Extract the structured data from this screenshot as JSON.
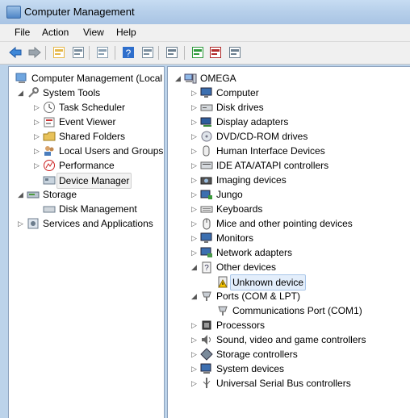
{
  "window": {
    "title": "Computer Management"
  },
  "menu": [
    "File",
    "Action",
    "View",
    "Help"
  ],
  "toolbar": [
    "back-icon",
    "forward-icon",
    "up-folder-icon",
    "show-hide-tree-icon",
    "properties-icon",
    "help-icon",
    "show-action-pane-icon",
    "scan-hardware-icon",
    "update-driver-icon",
    "uninstall-icon",
    "disable-icon"
  ],
  "left_tree": [
    {
      "label": "Computer Management (Local",
      "level": 0,
      "expander": "",
      "icon": "computer-management-icon"
    },
    {
      "label": "System Tools",
      "level": 1,
      "expander": "▲",
      "icon": "system-tools-icon"
    },
    {
      "label": "Task Scheduler",
      "level": 2,
      "expander": "▷",
      "icon": "clock-icon"
    },
    {
      "label": "Event Viewer",
      "level": 2,
      "expander": "▷",
      "icon": "event-viewer-icon"
    },
    {
      "label": "Shared Folders",
      "level": 2,
      "expander": "▷",
      "icon": "shared-folder-icon"
    },
    {
      "label": "Local Users and Groups",
      "level": 2,
      "expander": "▷",
      "icon": "users-icon"
    },
    {
      "label": "Performance",
      "level": 2,
      "expander": "▷",
      "icon": "performance-icon"
    },
    {
      "label": "Device Manager",
      "level": 2,
      "expander": "",
      "icon": "device-manager-icon",
      "selected": true
    },
    {
      "label": "Storage",
      "level": 1,
      "expander": "▲",
      "icon": "storage-icon"
    },
    {
      "label": "Disk Management",
      "level": 2,
      "expander": "",
      "icon": "disk-icon"
    },
    {
      "label": "Services and Applications",
      "level": 1,
      "expander": "▷",
      "icon": "services-icon"
    }
  ],
  "right_tree": [
    {
      "label": "OMEGA",
      "level": 0,
      "expander": "▲",
      "icon": "computer-icon"
    },
    {
      "label": "Computer",
      "level": 1,
      "expander": "▷",
      "icon": "monitor-icon"
    },
    {
      "label": "Disk drives",
      "level": 1,
      "expander": "▷",
      "icon": "disk-drive-icon"
    },
    {
      "label": "Display adapters",
      "level": 1,
      "expander": "▷",
      "icon": "display-adapter-icon"
    },
    {
      "label": "DVD/CD-ROM drives",
      "level": 1,
      "expander": "▷",
      "icon": "dvd-icon"
    },
    {
      "label": "Human Interface Devices",
      "level": 1,
      "expander": "▷",
      "icon": "hid-icon"
    },
    {
      "label": "IDE ATA/ATAPI controllers",
      "level": 1,
      "expander": "▷",
      "icon": "ide-controller-icon"
    },
    {
      "label": "Imaging devices",
      "level": 1,
      "expander": "▷",
      "icon": "camera-icon"
    },
    {
      "label": "Jungo",
      "level": 1,
      "expander": "▷",
      "icon": "jungo-icon"
    },
    {
      "label": "Keyboards",
      "level": 1,
      "expander": "▷",
      "icon": "keyboard-icon"
    },
    {
      "label": "Mice and other pointing devices",
      "level": 1,
      "expander": "▷",
      "icon": "mouse-icon"
    },
    {
      "label": "Monitors",
      "level": 1,
      "expander": "▷",
      "icon": "monitor-icon"
    },
    {
      "label": "Network adapters",
      "level": 1,
      "expander": "▷",
      "icon": "network-adapter-icon"
    },
    {
      "label": "Other devices",
      "level": 1,
      "expander": "▲",
      "icon": "other-devices-icon"
    },
    {
      "label": "Unknown device",
      "level": 2,
      "expander": "",
      "icon": "warning-device-icon",
      "selected": true
    },
    {
      "label": "Ports (COM & LPT)",
      "level": 1,
      "expander": "▲",
      "icon": "port-icon"
    },
    {
      "label": "Communications Port (COM1)",
      "level": 2,
      "expander": "",
      "icon": "port-icon"
    },
    {
      "label": "Processors",
      "level": 1,
      "expander": "▷",
      "icon": "processor-icon"
    },
    {
      "label": "Sound, video and game controllers",
      "level": 1,
      "expander": "▷",
      "icon": "sound-icon"
    },
    {
      "label": "Storage controllers",
      "level": 1,
      "expander": "▷",
      "icon": "storage-controller-icon"
    },
    {
      "label": "System devices",
      "level": 1,
      "expander": "▷",
      "icon": "system-devices-icon"
    },
    {
      "label": "Universal Serial Bus controllers",
      "level": 1,
      "expander": "▷",
      "icon": "usb-icon"
    }
  ],
  "colors": {
    "accent": "#3a6ea5",
    "selection": "#e3eefb",
    "warning": "#f5c400"
  }
}
